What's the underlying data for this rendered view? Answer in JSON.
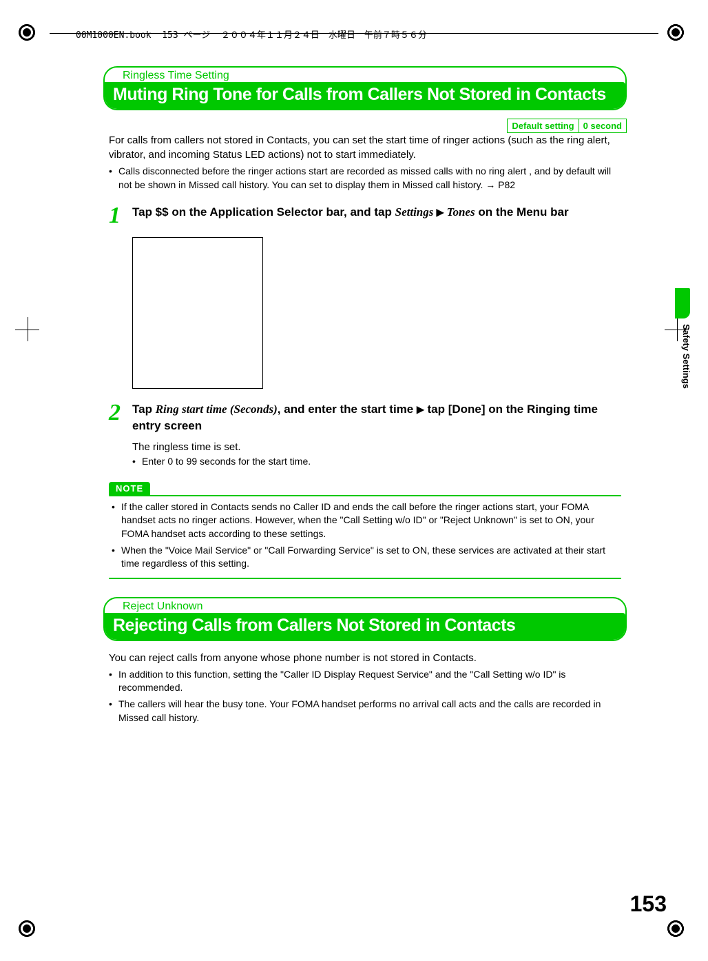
{
  "print_header": "00M1000EN.book  153 ページ  ２００４年１１月２４日　水曜日　午前７時５６分",
  "side_label": "Safety Settings",
  "page_number": "153",
  "section1": {
    "tag": "Ringless Time Setting",
    "title": "Muting Ring Tone for Calls from Callers Not Stored in Contacts",
    "default_label": "Default setting",
    "default_value": "0 second",
    "intro": "For calls from callers not stored in Contacts, you can set the start time of ringer actions (such as the ring alert, vibrator, and incoming Status LED actions) not to start immediately.",
    "bullet1": "Calls disconnected before the ringer actions start are recorded as missed calls with no ring alert , and by default will not be shown in Missed call history. You can set to display them in Missed call history. → P82",
    "step1": {
      "pre": "Tap $$ on the Application Selector bar, and tap ",
      "em1": "Settings ",
      "em2": " Tones",
      "post": " on the Menu bar"
    },
    "step2": {
      "pre": "Tap ",
      "em1": "Ring start time (Seconds)",
      "mid": ", and enter the start time ",
      "post": " tap [Done] on the Ringing time entry screen",
      "sub": "The ringless time is set.",
      "sub_bullet": "Enter 0 to 99 seconds for the start time."
    },
    "note_label": "NOTE",
    "note1": "If the caller stored in Contacts sends no Caller ID and ends the call before the ringer actions start, your FOMA handset acts no ringer actions. However, when the \"Call Setting w/o ID\" or \"Reject Unknown\" is set to ON, your FOMA handset acts according to these settings.",
    "note2": "When the \"Voice Mail Service\" or \"Call Forwarding Service\" is set to ON, these services are activated at their start time regardless of this setting."
  },
  "section2": {
    "tag": "Reject Unknown",
    "title": "Rejecting Calls from Callers Not Stored in Contacts",
    "intro": "You can reject calls from anyone whose phone number is not stored in Contacts.",
    "bullet1": "In addition to this function, setting the \"Caller ID Display Request Service\" and the \"Call Setting w/o ID\" is recommended.",
    "bullet2": "The callers will hear the busy tone. Your FOMA handset performs no arrival call acts and the calls are recorded in Missed call history."
  }
}
